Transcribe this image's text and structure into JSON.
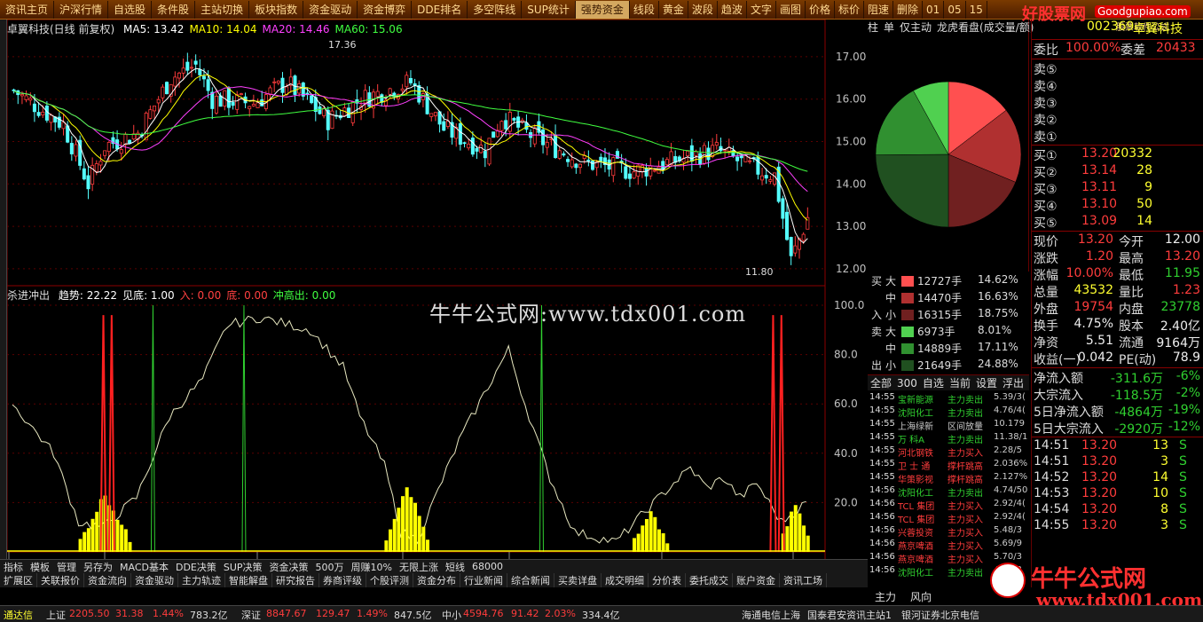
{
  "toolbar": {
    "items": [
      "资讯主页",
      "沪深行情",
      "自选股",
      "条件股",
      "主站切换",
      "板块指数",
      "资金驱动",
      "资金博弈",
      "DDE排名",
      "多空阵线",
      "SUP统计",
      "强势资金",
      "线段",
      "黄金",
      "波段",
      "趋波",
      "文字",
      "画图",
      "价格",
      "标价",
      "阻速",
      "删除",
      "01",
      "05",
      "15"
    ],
    "active_index": 11
  },
  "brand_top": {
    "name": "好股票网",
    "url": "Goodgupiao.com",
    "sub": "股票软件公式"
  },
  "chart": {
    "title": "卓翼科技(日线 前复权)",
    "ma": [
      {
        "label": "MA5: 13.42",
        "color": "#ffffff"
      },
      {
        "label": "MA10: 14.04",
        "color": "#ffff00"
      },
      {
        "label": "MA20: 14.46",
        "color": "#ff40ff"
      },
      {
        "label": "MA60: 15.06",
        "color": "#40ff40"
      }
    ],
    "high_label": "17.36",
    "low_label": "11.80",
    "price_axis": [
      "17.00",
      "16.00",
      "15.00",
      "14.00",
      "13.00",
      "12.00"
    ],
    "date_labels": [
      "2012年",
      "12",
      "1",
      "2",
      "3",
      "4",
      "5"
    ],
    "period": "日线"
  },
  "indicator": {
    "name": "杀进冲出",
    "fields": [
      {
        "label": "趋势: 22.22",
        "color": "#ffffff"
      },
      {
        "label": "见底: 1.00",
        "color": "#ffffff"
      },
      {
        "label": "入: 0.00",
        "color": "#ff4040"
      },
      {
        "label": "底: 0.00",
        "color": "#ff4040"
      },
      {
        "label": "冲高出: 0.00",
        "color": "#40ff40"
      }
    ],
    "axis": [
      "100.0",
      "80.0",
      "60.0",
      "40.0",
      "20.0"
    ]
  },
  "watermark": "牛牛公式网:www.tdx001.com",
  "pie": {
    "tabs": [
      "柱",
      "单",
      "仅主动",
      "龙虎看盘(成交量/额)"
    ],
    "slices": [
      {
        "value": 14.62,
        "color": "#ff5050"
      },
      {
        "value": 16.63,
        "color": "#b03030"
      },
      {
        "value": 18.75,
        "color": "#702020"
      },
      {
        "value": 24.88,
        "color": "#205020"
      },
      {
        "value": 17.11,
        "color": "#309030"
      },
      {
        "value": 8.01,
        "color": "#50d050"
      }
    ]
  },
  "flow": {
    "rows": [
      {
        "side": "买",
        "size": "大",
        "color": "#ff5050",
        "val": "12727手",
        "pct": "14.62%"
      },
      {
        "side": "",
        "size": "中",
        "color": "#b03030",
        "val": "14470手",
        "pct": "16.63%"
      },
      {
        "side": "入",
        "size": "小",
        "color": "#702020",
        "val": "16315手",
        "pct": "18.75%"
      },
      {
        "side": "卖",
        "size": "大",
        "color": "#50d050",
        "val": "6973手",
        "pct": "8.01%"
      },
      {
        "side": "",
        "size": "中",
        "color": "#309030",
        "val": "14889手",
        "pct": "17.11%"
      },
      {
        "side": "出",
        "size": "小",
        "color": "#205020",
        "val": "21649手",
        "pct": "24.88%"
      }
    ]
  },
  "tick_tabs": [
    "全部",
    "300",
    "自选",
    "当前",
    "设置",
    "浮出"
  ],
  "ticks": [
    {
      "t": "14:55",
      "n": "宝新能源",
      "a": "主力卖出",
      "v": "5.39/3(",
      "c": "#30d030"
    },
    {
      "t": "14:55",
      "n": "沈阳化工",
      "a": "主力卖出",
      "v": "4.76/4(",
      "c": "#30d030"
    },
    {
      "t": "14:55",
      "n": "上海绿新",
      "a": "区间放量",
      "v": "10.179",
      "c": "#cccccc"
    },
    {
      "t": "14:55",
      "n": "万 科A",
      "a": "主力卖出",
      "v": "11.38/1",
      "c": "#30d030"
    },
    {
      "t": "14:55",
      "n": "河北钢铁",
      "a": "主力买入",
      "v": "2.28/5",
      "c": "#ff3c3c"
    },
    {
      "t": "14:55",
      "n": "卫 士 通",
      "a": "撑杆跳高",
      "v": "2.036%",
      "c": "#ff3c3c"
    },
    {
      "t": "14:55",
      "n": "华策影视",
      "a": "撑杆跳高",
      "v": "2.127%",
      "c": "#ff3c3c"
    },
    {
      "t": "14:56",
      "n": "沈阳化工",
      "a": "主力卖出",
      "v": "4.74/50",
      "c": "#30d030"
    },
    {
      "t": "14:56",
      "n": "TCL 集团",
      "a": "主力买入",
      "v": "2.92/4(",
      "c": "#ff3c3c"
    },
    {
      "t": "14:56",
      "n": "TCL 集团",
      "a": "主力买入",
      "v": "2.92/4(",
      "c": "#ff3c3c"
    },
    {
      "t": "14:56",
      "n": "兴蓉投资",
      "a": "主力买入",
      "v": "5.48/3",
      "c": "#ff3c3c"
    },
    {
      "t": "14:56",
      "n": "燕京啤酒",
      "a": "主力买入",
      "v": "5.69/9",
      "c": "#ff3c3c"
    },
    {
      "t": "14:56",
      "n": "燕京啤酒",
      "a": "主力买入",
      "v": "5.70/3",
      "c": "#ff3c3c"
    },
    {
      "t": "14:56",
      "n": "沈阳化工",
      "a": "主力卖出",
      "v": "4.73/2",
      "c": "#30d030"
    }
  ],
  "quote": {
    "code": "002369",
    "name": "卓翼科技",
    "weibi_label": "委比",
    "weibi": "100.00%",
    "weicha_label": "委差",
    "weicha": "20433",
    "sell": [
      "卖⑤",
      "卖④",
      "卖③",
      "卖②",
      "卖①"
    ],
    "buy": [
      {
        "l": "买①",
        "p": "13.20",
        "v": "20332"
      },
      {
        "l": "买②",
        "p": "13.14",
        "v": "28"
      },
      {
        "l": "买③",
        "p": "13.11",
        "v": "9"
      },
      {
        "l": "买④",
        "p": "13.10",
        "v": "50"
      },
      {
        "l": "买⑤",
        "p": "13.09",
        "v": "14"
      }
    ],
    "stats": [
      {
        "l1": "现价",
        "v1": "13.20",
        "c1": "#ff3c3c",
        "l2": "今开",
        "v2": "12.00",
        "c2": "#eeeeee"
      },
      {
        "l1": "涨跌",
        "v1": "1.20",
        "c1": "#ff3c3c",
        "l2": "最高",
        "v2": "13.20",
        "c2": "#ff3c3c"
      },
      {
        "l1": "涨幅",
        "v1": "10.00%",
        "c1": "#ff3c3c",
        "l2": "最低",
        "v2": "11.95",
        "c2": "#30d030"
      },
      {
        "l1": "总量",
        "v1": "43532",
        "c1": "#ffff30",
        "l2": "量比",
        "v2": "1.23",
        "c2": "#ff3c3c"
      },
      {
        "l1": "外盘",
        "v1": "19754",
        "c1": "#ff3c3c",
        "l2": "内盘",
        "v2": "23778",
        "c2": "#30d030"
      },
      {
        "l1": "换手",
        "v1": "4.75%",
        "c1": "#eeeeee",
        "l2": "股本",
        "v2": "2.40亿",
        "c2": "#eeeeee"
      },
      {
        "l1": "净资",
        "v1": "5.51",
        "c1": "#eeeeee",
        "l2": "流通",
        "v2": "9164万",
        "c2": "#eeeeee"
      },
      {
        "l1": "收益(一)",
        "v1": "0.042",
        "c1": "#eeeeee",
        "l2": "PE(动)",
        "v2": "78.9",
        "c2": "#eeeeee"
      }
    ],
    "fund": [
      {
        "l": "净流入额",
        "v": "-311.6万",
        "p": "-6%"
      },
      {
        "l": "大宗流入",
        "v": "-118.5万",
        "p": "-2%"
      },
      {
        "l": "5日净流入额",
        "v": "-4864万",
        "p": "-19%"
      },
      {
        "l": "5日大宗流入",
        "v": "-2920万",
        "p": "-12%"
      }
    ],
    "trades": [
      {
        "t": "14:51",
        "p": "13.20",
        "v": "13",
        "s": "S"
      },
      {
        "t": "14:51",
        "p": "13.20",
        "v": "3",
        "s": "S"
      },
      {
        "t": "14:52",
        "p": "13.20",
        "v": "14",
        "s": "S"
      },
      {
        "t": "14:53",
        "p": "13.20",
        "v": "10",
        "s": "S"
      },
      {
        "t": "14:54",
        "p": "13.20",
        "v": "8",
        "s": "S"
      },
      {
        "t": "14:55",
        "p": "13.20",
        "v": "3",
        "s": "S"
      }
    ]
  },
  "bottom_tabs1": [
    "指标",
    "模板",
    "管理",
    "另存为",
    "MACD基本",
    "DDE决策",
    "SUP决策",
    "资金决策",
    "500万",
    "周赚10%",
    "无限上涨",
    "短线",
    "68000"
  ],
  "bottom_tabs2": [
    "扩展区",
    "关联报价",
    "资金流向",
    "资金驱动",
    "主力轨迹",
    "智能解盘",
    "研究报告",
    "券商评级",
    "个股评测",
    "资金分布",
    "行业新闻",
    "综合新闻",
    "买卖详盘",
    "成交明细",
    "分价表",
    "委托成交",
    "账户资金",
    "资讯工场"
  ],
  "rp_bottom_tabs": [
    "主力",
    "风向"
  ],
  "status": [
    {
      "text": "通达信",
      "c": "#ffff30"
    },
    {
      "text": "上证",
      "c": "#dddddd"
    },
    {
      "text": "2205.50",
      "c": "#ff3c3c"
    },
    {
      "text": "31.38",
      "c": "#ff3c3c"
    },
    {
      "text": "1.44%",
      "c": "#ff3c3c"
    },
    {
      "text": "783.2亿",
      "c": "#dddddd"
    },
    {
      "text": "深证",
      "c": "#dddddd"
    },
    {
      "text": "8847.67",
      "c": "#ff3c3c"
    },
    {
      "text": "129.47",
      "c": "#ff3c3c"
    },
    {
      "text": "1.49%",
      "c": "#ff3c3c"
    },
    {
      "text": "847.5亿",
      "c": "#dddddd"
    },
    {
      "text": "中小",
      "c": "#dddddd"
    },
    {
      "text": "4594.76",
      "c": "#ff3c3c"
    },
    {
      "text": "91.42",
      "c": "#ff3c3c"
    },
    {
      "text": "2.03%",
      "c": "#ff3c3c"
    },
    {
      "text": "334.4亿",
      "c": "#dddddd"
    },
    {
      "text": "海通电信上海",
      "c": "#dddddd"
    },
    {
      "text": "国泰君安资讯主站1",
      "c": "#dddddd"
    },
    {
      "text": "银河证券北京电信",
      "c": "#dddddd"
    }
  ],
  "brand_bottom": {
    "cn": "牛牛公式网",
    "en": "www.tdx001.com"
  }
}
